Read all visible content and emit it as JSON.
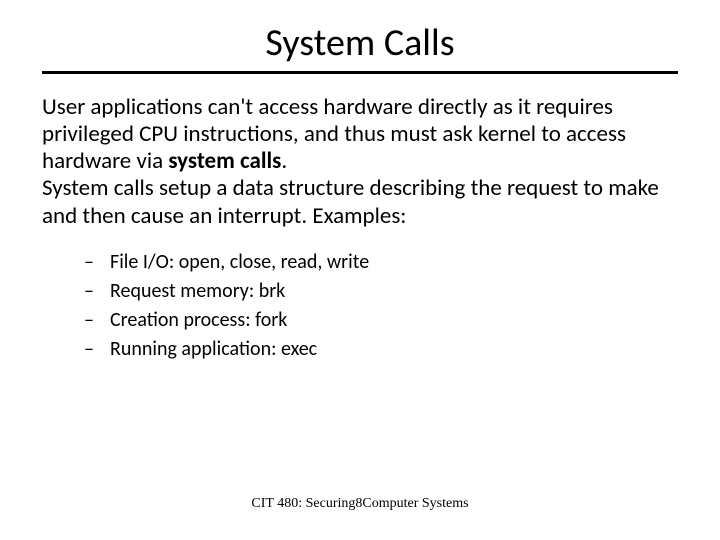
{
  "title": "System Calls",
  "paragraph1_part1": "User applications can't access hardware directly as it requires privileged CPU instructions, and thus must ask kernel to access hardware via ",
  "paragraph1_bold": "system calls",
  "paragraph1_part2": ".",
  "paragraph2": "System calls setup a data structure describing the request to make and then cause an interrupt. Examples:",
  "list": [
    "File I/O: open, close, read, write",
    "Request memory: brk",
    "Creation process: fork",
    "Running application: exec"
  ],
  "footer_left": "CIT 480: Securing",
  "footer_page": "8",
  "footer_right": "Computer Systems"
}
